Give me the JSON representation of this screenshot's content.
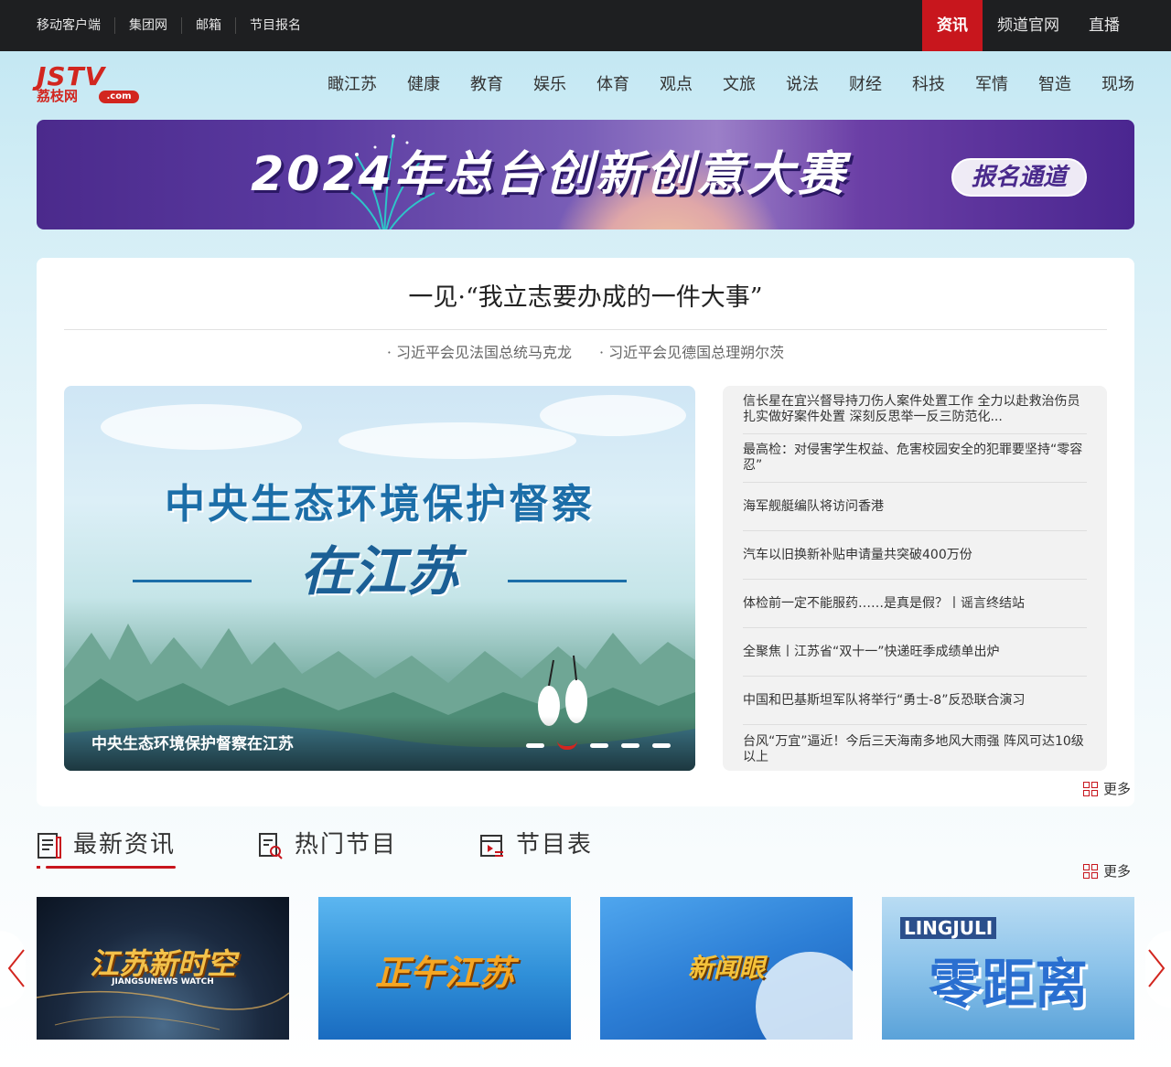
{
  "topbar": {
    "left_links": [
      "移动客户端",
      "集团网",
      "邮箱",
      "节目报名"
    ],
    "right_links": [
      {
        "label": "资讯",
        "active": true
      },
      {
        "label": "频道官网",
        "active": false
      },
      {
        "label": "直播",
        "active": false
      }
    ]
  },
  "logo": {
    "main": "JSTV",
    "sub": "荔枝网",
    "suffix": ".com"
  },
  "nav": [
    "瞰江苏",
    "健康",
    "教育",
    "娱乐",
    "体育",
    "观点",
    "文旅",
    "说法",
    "财经",
    "科技",
    "军情",
    "智造",
    "现场"
  ],
  "banner": {
    "title": "2024年总台创新创意大赛",
    "button": "报名通道"
  },
  "headline": {
    "title": "一见·“我立志要办成的一件大事”",
    "subheads": [
      "· 习近平会见法国总统马克龙",
      "· 习近平会见德国总理朔尔茨"
    ]
  },
  "slider": {
    "title": "中央生态环境保护督察",
    "subtitle": "在江苏",
    "caption": "中央生态环境保护督察在江苏",
    "slide_count": 5,
    "active_index": 1
  },
  "news": [
    "信长星在宜兴督导持刀伤人案件处置工作 全力以赴救治伤员 扎实做好案件处置 深刻反思举一反三防范化...",
    "最高检：对侵害学生权益、危害校园安全的犯罪要坚持“零容忍”",
    "海军舰艇编队将访问香港",
    "汽车以旧换新补贴申请量共突破400万份",
    "体检前一定不能服药……是真是假？丨谣言终结站",
    "全聚焦丨江苏省“双十一”快递旺季成绩单出炉",
    "中国和巴基斯坦军队将举行“勇士-8”反恐联合演习",
    "台风“万宜”逼近！今后三天海南多地风大雨强 阵风可达10级以上"
  ],
  "more_label": "更多",
  "tabs": [
    {
      "label": "最新资讯",
      "icon": "news-doc-icon",
      "active": true
    },
    {
      "label": "热门节目",
      "icon": "hot-program-icon",
      "active": false
    },
    {
      "label": "节目表",
      "icon": "schedule-icon",
      "active": false
    }
  ],
  "programs": [
    {
      "title": "江苏新时空",
      "subtitle": "JIANGSUNEWS WATCH"
    },
    {
      "title": "正午江苏",
      "subtitle": ""
    },
    {
      "title": "新闻眼",
      "subtitle": ""
    },
    {
      "title": "零距离",
      "subtitle": "LINGJULI"
    }
  ],
  "colors": {
    "accent": "#c8161d",
    "topbar_bg": "#1e1f21",
    "banner_purple": "#5a3aa0"
  }
}
